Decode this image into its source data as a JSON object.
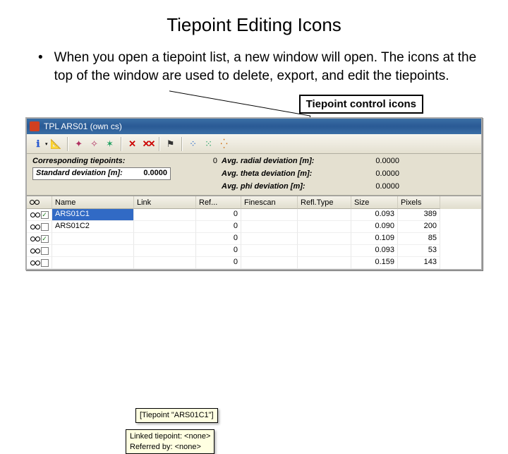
{
  "slide": {
    "title": "Tiepoint Editing Icons",
    "bullet": "When you open a tiepoint list, a new window will open. The icons at the top of the window are used to delete, export, and edit the tiepoints.",
    "callout": "Tiepoint control icons"
  },
  "window": {
    "title": "TPL ARS01 (own cs)"
  },
  "toolbar": {
    "icons": [
      "info",
      "ruler",
      "new",
      "open",
      "save",
      "delete1",
      "delete2",
      "delete-colored",
      "delete-x",
      "delete-xx",
      "flag",
      "plot-a",
      "plot-b",
      "plot-c"
    ]
  },
  "stats": {
    "corresp_label": "Corresponding tiepoints:",
    "corresp_value": "0",
    "std_label": "Standard deviation [m]:",
    "std_value": "0.0000",
    "avg_radial_label": "Avg. radial deviation [m]:",
    "avg_radial_value": "0.0000",
    "avg_theta_label": "Avg. theta deviation [m]:",
    "avg_theta_value": "0.0000",
    "avg_phi_label": "Avg. phi deviation [m]:",
    "avg_phi_value": "0.0000"
  },
  "table": {
    "headers": [
      "",
      "Name",
      "Link",
      "Ref...",
      "Finescan",
      "Refl.Type",
      "Size",
      "Pixels"
    ],
    "rows": [
      {
        "selected": true,
        "checked": true,
        "name": "ARS01C1",
        "link": "",
        "ref": "0",
        "finescan": "",
        "refltype": "",
        "size": "0.093",
        "pixels": "389"
      },
      {
        "selected": false,
        "checked": false,
        "name": "ARS01C2",
        "link": "",
        "ref": "0",
        "finescan": "",
        "refltype": "",
        "size": "0.090",
        "pixels": "200"
      },
      {
        "selected": false,
        "checked": true,
        "name": "",
        "link": "",
        "ref": "0",
        "finescan": "",
        "refltype": "",
        "size": "0.109",
        "pixels": "85"
      },
      {
        "selected": false,
        "checked": false,
        "name": "",
        "link": "",
        "ref": "0",
        "finescan": "",
        "refltype": "",
        "size": "0.093",
        "pixels": "53"
      },
      {
        "selected": false,
        "checked": false,
        "name": "",
        "link": "",
        "ref": "0",
        "finescan": "",
        "refltype": "",
        "size": "0.159",
        "pixels": "143"
      }
    ]
  },
  "tooltips": {
    "tip1": "[Tiepoint \"ARS01C1\"]",
    "tip2_line1": "Linked tiepoint: <none>",
    "tip2_line2": "Referred by: <none>"
  }
}
